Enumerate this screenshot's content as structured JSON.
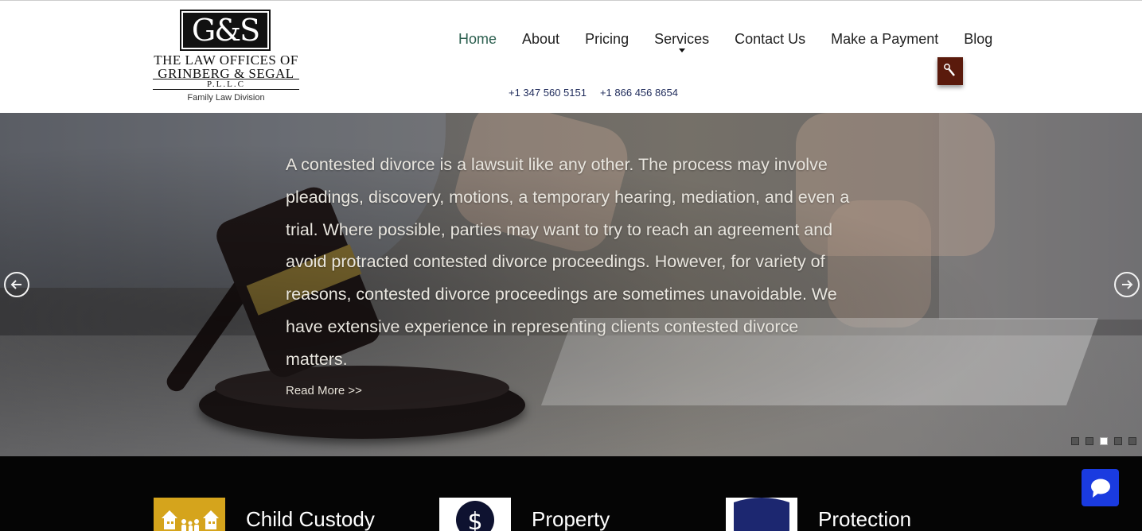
{
  "logo": {
    "mark": "G&S",
    "line1": "THE LAW OFFICES OF",
    "line2": "GRINBERG & SEGAL",
    "pllc": "P.L.L.C",
    "division": "Family Law Division"
  },
  "nav": {
    "items": [
      {
        "label": "Home",
        "active": true
      },
      {
        "label": "About"
      },
      {
        "label": "Pricing"
      },
      {
        "label": "Services",
        "has_dropdown": true
      },
      {
        "label": "Contact Us"
      },
      {
        "label": "Make a Payment"
      },
      {
        "label": "Blog"
      }
    ],
    "phones": [
      "+1 347 560 5151",
      "+1 866 456 8654"
    ],
    "search_icon": "search-icon"
  },
  "hero": {
    "text": "A contested divorce is a lawsuit like any other. The process may involve pleadings, discovery, motions, a temporary hearing, mediation, and even a trial. Where possible, parties may want to try to reach an agreement and avoid protracted contested divorce proceedings. However, for variety of reasons, contested divorce proceedings are sometimes unavoidable. We have extensive experience in representing clients contested divorce matters.",
    "read_more": "Read More >>",
    "slide_count": 5,
    "active_slide": 3
  },
  "services": {
    "items": [
      {
        "label": "Child Custody",
        "icon": "family-houses-icon"
      },
      {
        "label": "Property",
        "icon": "dollar-icon"
      },
      {
        "label": "Protection",
        "icon": "shield-icon"
      }
    ]
  },
  "colors": {
    "nav_active": "#2c5f4f",
    "phone": "#1e2a5a",
    "search_button": "#5a1a0c",
    "chat_button": "#1a3be0",
    "custody_icon_bg": "#d5a41c",
    "services_bg": "#050505"
  }
}
